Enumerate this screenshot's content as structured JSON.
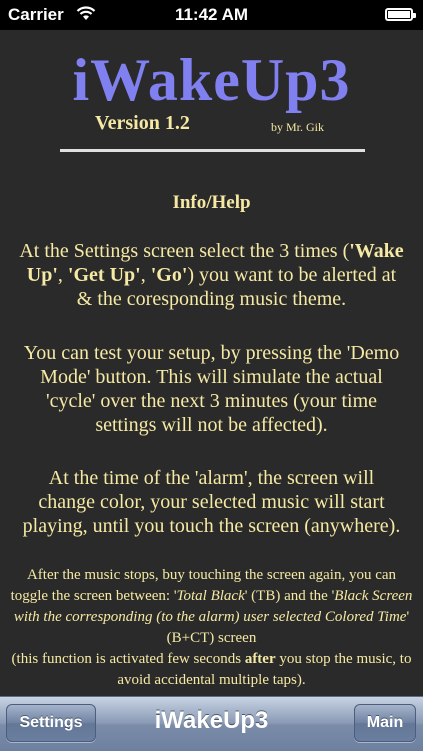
{
  "status_bar": {
    "carrier": "Carrier",
    "wifi_icon": "wifi-icon",
    "time": "11:42 AM",
    "battery_icon": "battery-full-icon",
    "battery_level": 1.0
  },
  "content": {
    "app_title": "iWakeUp3",
    "version": "Version 1.2",
    "author": "by Mr. Gik",
    "section_title": "Info/Help",
    "para1": {
      "a": "At the Settings screen select the 3 times (",
      "t1": "'Wake Up'",
      "sep1": ", ",
      "t2": "'Get Up'",
      "sep2": ", ",
      "t3": "'Go'",
      "b": ") you want to be alerted at & the coresponding music theme."
    },
    "para2": "You can test your setup, by pressing the 'Demo Mode' button. This will simulate the actual 'cycle' over the next 3 minutes (your time settings will not be affected).",
    "para3": "At the time of the 'alarm', the screen will change color, your selected music will start playing, until you touch the screen (anywhere).",
    "para4": {
      "a": "After the music stops, buy touching the screen again, you can toggle the screen between: '",
      "tb": "Total Black",
      "b": "' (TB) and the '",
      "bct": "Black Screen with the corresponding (to the alarm) user selected Colored Time",
      "c": "' (B+CT) screen",
      "d": "(this function is activated few seconds ",
      "after": "after",
      "e": " you stop the music, to avoid accidental multiple taps)."
    }
  },
  "nav_bar": {
    "settings_label": "Settings",
    "title": "iWakeUp3",
    "main_label": "Main"
  },
  "colors": {
    "background": "#2a2a2a",
    "title": "#8080f0",
    "text": "#f5e9a3"
  }
}
